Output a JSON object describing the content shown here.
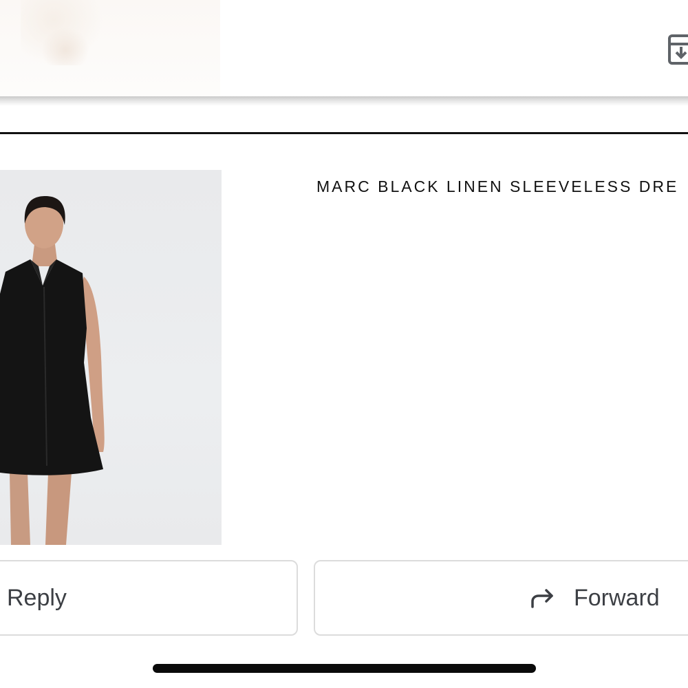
{
  "header": {
    "download_icon": "archive-download-icon"
  },
  "product": {
    "title": "MARC BLACK LINEN SLEEVELESS DRE",
    "image_alt_icon": "product-photo"
  },
  "actions": {
    "reply_label": "Reply",
    "forward_label": "Forward",
    "forward_icon": "forward-arrow-icon"
  },
  "colors": {
    "text": "#111111",
    "button_text": "#3c3f44",
    "button_border": "#dcdcdc",
    "divider": "#111111",
    "photo_background": "#eaebed"
  }
}
